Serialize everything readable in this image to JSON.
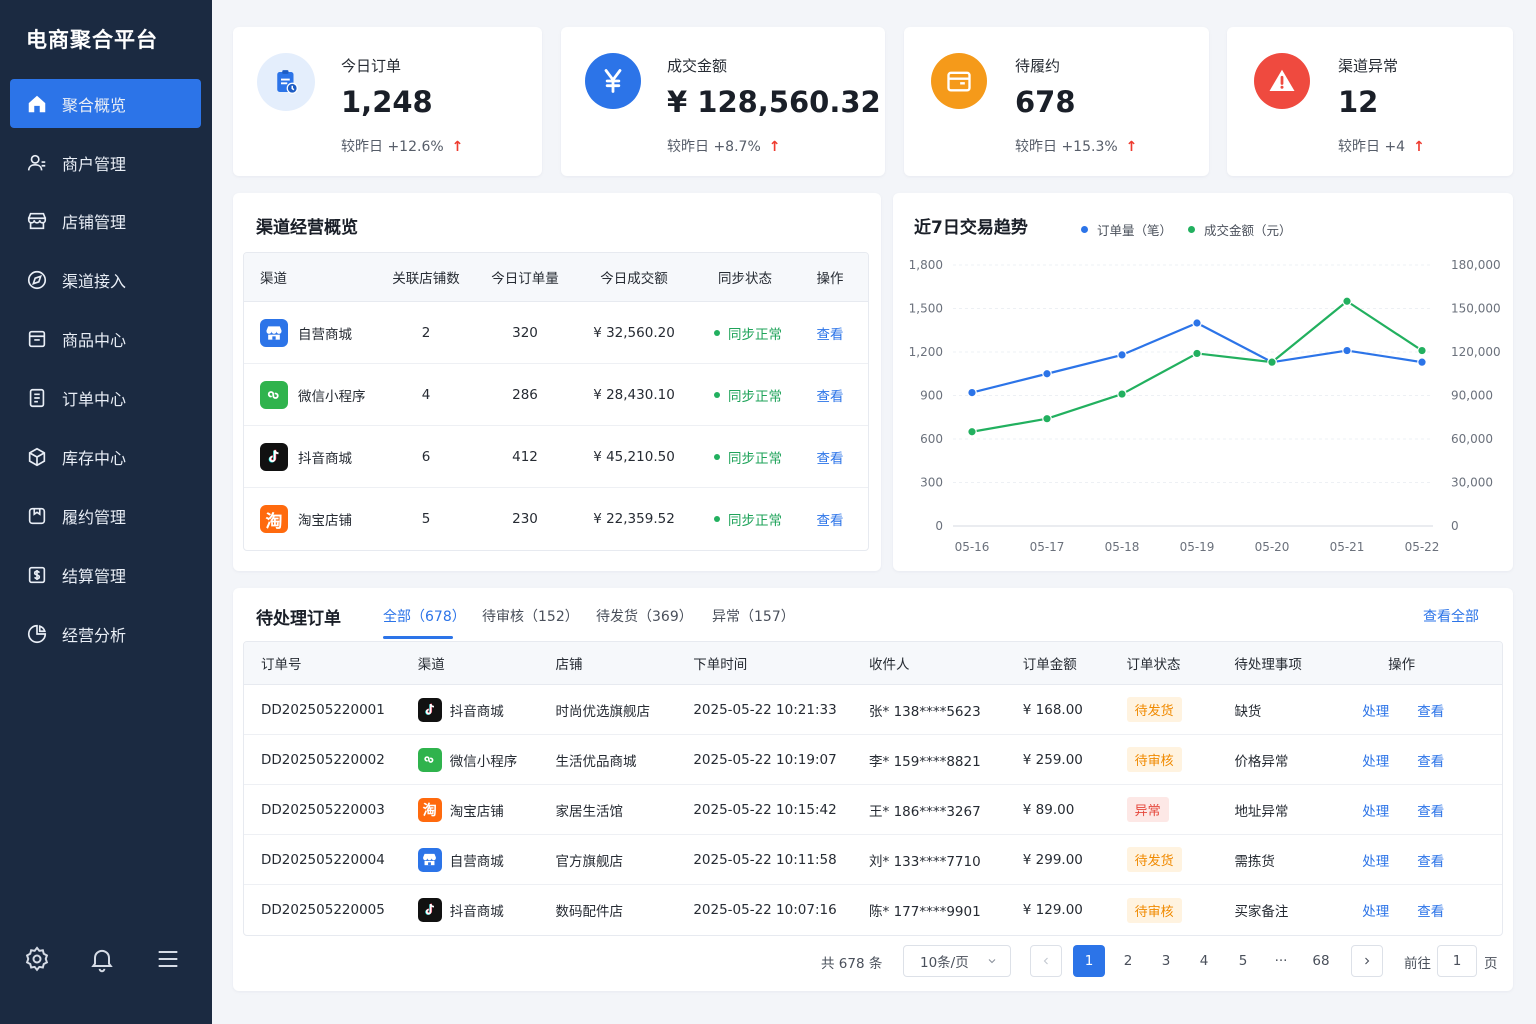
{
  "app": {
    "title": "电商聚合平台"
  },
  "sidebar": {
    "items": [
      {
        "label": "聚合概览",
        "icon": "home-icon",
        "active": true
      },
      {
        "label": "商户管理",
        "icon": "merchant-icon"
      },
      {
        "label": "店铺管理",
        "icon": "store-icon"
      },
      {
        "label": "渠道接入",
        "icon": "channel-icon"
      },
      {
        "label": "商品中心",
        "icon": "product-icon"
      },
      {
        "label": "订单中心",
        "icon": "order-icon"
      },
      {
        "label": "库存中心",
        "icon": "inventory-icon"
      },
      {
        "label": "履约管理",
        "icon": "fulfillment-icon"
      },
      {
        "label": "结算管理",
        "icon": "settlement-icon"
      },
      {
        "label": "经营分析",
        "icon": "analytics-icon"
      }
    ],
    "bottom_icons": [
      "gear-icon",
      "bell-icon",
      "menu-icon"
    ]
  },
  "kpis": [
    {
      "label": "今日订单",
      "value": "1,248",
      "compare": "较昨日 +12.6%",
      "color": "#2c74e8",
      "icon": "clipboard-icon"
    },
    {
      "label": "成交金额",
      "value": "¥ 128,560.32",
      "compare": "较昨日 +8.7%",
      "color": "#2c74e8",
      "icon": "yen-icon"
    },
    {
      "label": "待履约",
      "value": "678",
      "compare": "较昨日 +15.3%",
      "color": "#f59a1a",
      "icon": "package-icon"
    },
    {
      "label": "渠道异常",
      "value": "12",
      "compare": "较昨日 +4",
      "color": "#ef4a3f",
      "icon": "warning-icon"
    }
  ],
  "channel_overview": {
    "title": "渠道经营概览",
    "headers": [
      "渠道",
      "关联店铺数",
      "今日订单量",
      "今日成交额",
      "同步状态",
      "操作"
    ],
    "rows": [
      {
        "channel": "自营商城",
        "stores": "2",
        "orders": "320",
        "amount": "¥ 32,560.20",
        "status": "同步正常",
        "action": "查看",
        "icon": "self-mall-icon"
      },
      {
        "channel": "微信小程序",
        "stores": "4",
        "orders": "286",
        "amount": "¥ 28,430.10",
        "status": "同步正常",
        "action": "查看",
        "icon": "wechat-mini-icon"
      },
      {
        "channel": "抖音商城",
        "stores": "6",
        "orders": "412",
        "amount": "¥ 45,210.50",
        "status": "同步正常",
        "action": "查看",
        "icon": "douyin-icon"
      },
      {
        "channel": "淘宝店铺",
        "stores": "5",
        "orders": "230",
        "amount": "¥ 22,359.52",
        "status": "同步正常",
        "action": "查看",
        "icon": "taobao-icon"
      }
    ]
  },
  "trend": {
    "title": "近7日交易趋势",
    "legend": [
      "订单量（笔）",
      "成交金额（元）"
    ]
  },
  "chart_data": {
    "type": "line",
    "x": [
      "05-16",
      "05-17",
      "05-18",
      "05-19",
      "05-20",
      "05-21",
      "05-22"
    ],
    "series": [
      {
        "name": "订单量（笔）",
        "axis": "left",
        "color": "#2c74e8",
        "values": [
          920,
          1050,
          1180,
          1400,
          1130,
          1210,
          1130
        ]
      },
      {
        "name": "成交金额（元）",
        "axis": "right",
        "color": "#22b05f",
        "values": [
          65000,
          74000,
          91000,
          119000,
          113000,
          155000,
          121000
        ]
      }
    ],
    "yticks_left": [
      "0",
      "300",
      "600",
      "900",
      "1,200",
      "1,500",
      "1,800"
    ],
    "yticks_right": [
      "0",
      "30,000",
      "60,000",
      "90,000",
      "120,000",
      "150,000",
      "180,000"
    ],
    "ylim_left": [
      0,
      1800
    ],
    "ylim_right": [
      0,
      180000
    ],
    "grid": true,
    "legend_position": "top"
  },
  "pending": {
    "title": "待处理订单",
    "tabs": [
      "全部（678）",
      "待审核（152）",
      "待发货（369）",
      "异常（157）"
    ],
    "view_all": "查看全部",
    "headers": [
      "订单号",
      "渠道",
      "店铺",
      "下单时间",
      "收件人",
      "订单金额",
      "订单状态",
      "待处理事项",
      "操作"
    ],
    "rows": [
      {
        "id": "DD202505220001",
        "channel": "抖音商城",
        "icon": "douyin-icon",
        "store": "时尚优选旗舰店",
        "time": "2025-05-22 10:21:33",
        "recipient": "张* 138****5623",
        "amount": "¥ 168.00",
        "status": "待发货",
        "status_type": "ship",
        "issue": "缺货",
        "act1": "处理",
        "act2": "查看"
      },
      {
        "id": "DD202505220002",
        "channel": "微信小程序",
        "icon": "wechat-mini-icon",
        "store": "生活优品商城",
        "time": "2025-05-22 10:19:07",
        "recipient": "李* 159****8821",
        "amount": "¥ 259.00",
        "status": "待审核",
        "status_type": "audit",
        "issue": "价格异常",
        "act1": "处理",
        "act2": "查看"
      },
      {
        "id": "DD202505220003",
        "channel": "淘宝店铺",
        "icon": "taobao-icon",
        "store": "家居生活馆",
        "time": "2025-05-22 10:15:42",
        "recipient": "王* 186****3267",
        "amount": "¥ 89.00",
        "status": "异常",
        "status_type": "err",
        "issue": "地址异常",
        "act1": "处理",
        "act2": "查看"
      },
      {
        "id": "DD202505220004",
        "channel": "自营商城",
        "icon": "self-mall-icon",
        "store": "官方旗舰店",
        "time": "2025-05-22 10:11:58",
        "recipient": "刘* 133****7710",
        "amount": "¥ 299.00",
        "status": "待发货",
        "status_type": "ship",
        "issue": "需拣货",
        "act1": "处理",
        "act2": "查看"
      },
      {
        "id": "DD202505220005",
        "channel": "抖音商城",
        "icon": "douyin-icon",
        "store": "数码配件店",
        "time": "2025-05-22 10:07:16",
        "recipient": "陈* 177****9901",
        "amount": "¥ 129.00",
        "status": "待审核",
        "status_type": "audit",
        "issue": "买家备注",
        "act1": "处理",
        "act2": "查看"
      }
    ]
  },
  "pagination": {
    "total": "共 678 条",
    "page_size": "10条/页",
    "pages": [
      "1",
      "2",
      "3",
      "4",
      "5",
      "···",
      "68"
    ],
    "current": "1",
    "goto_prefix": "前往",
    "goto_value": "1",
    "goto_suffix": "页"
  }
}
